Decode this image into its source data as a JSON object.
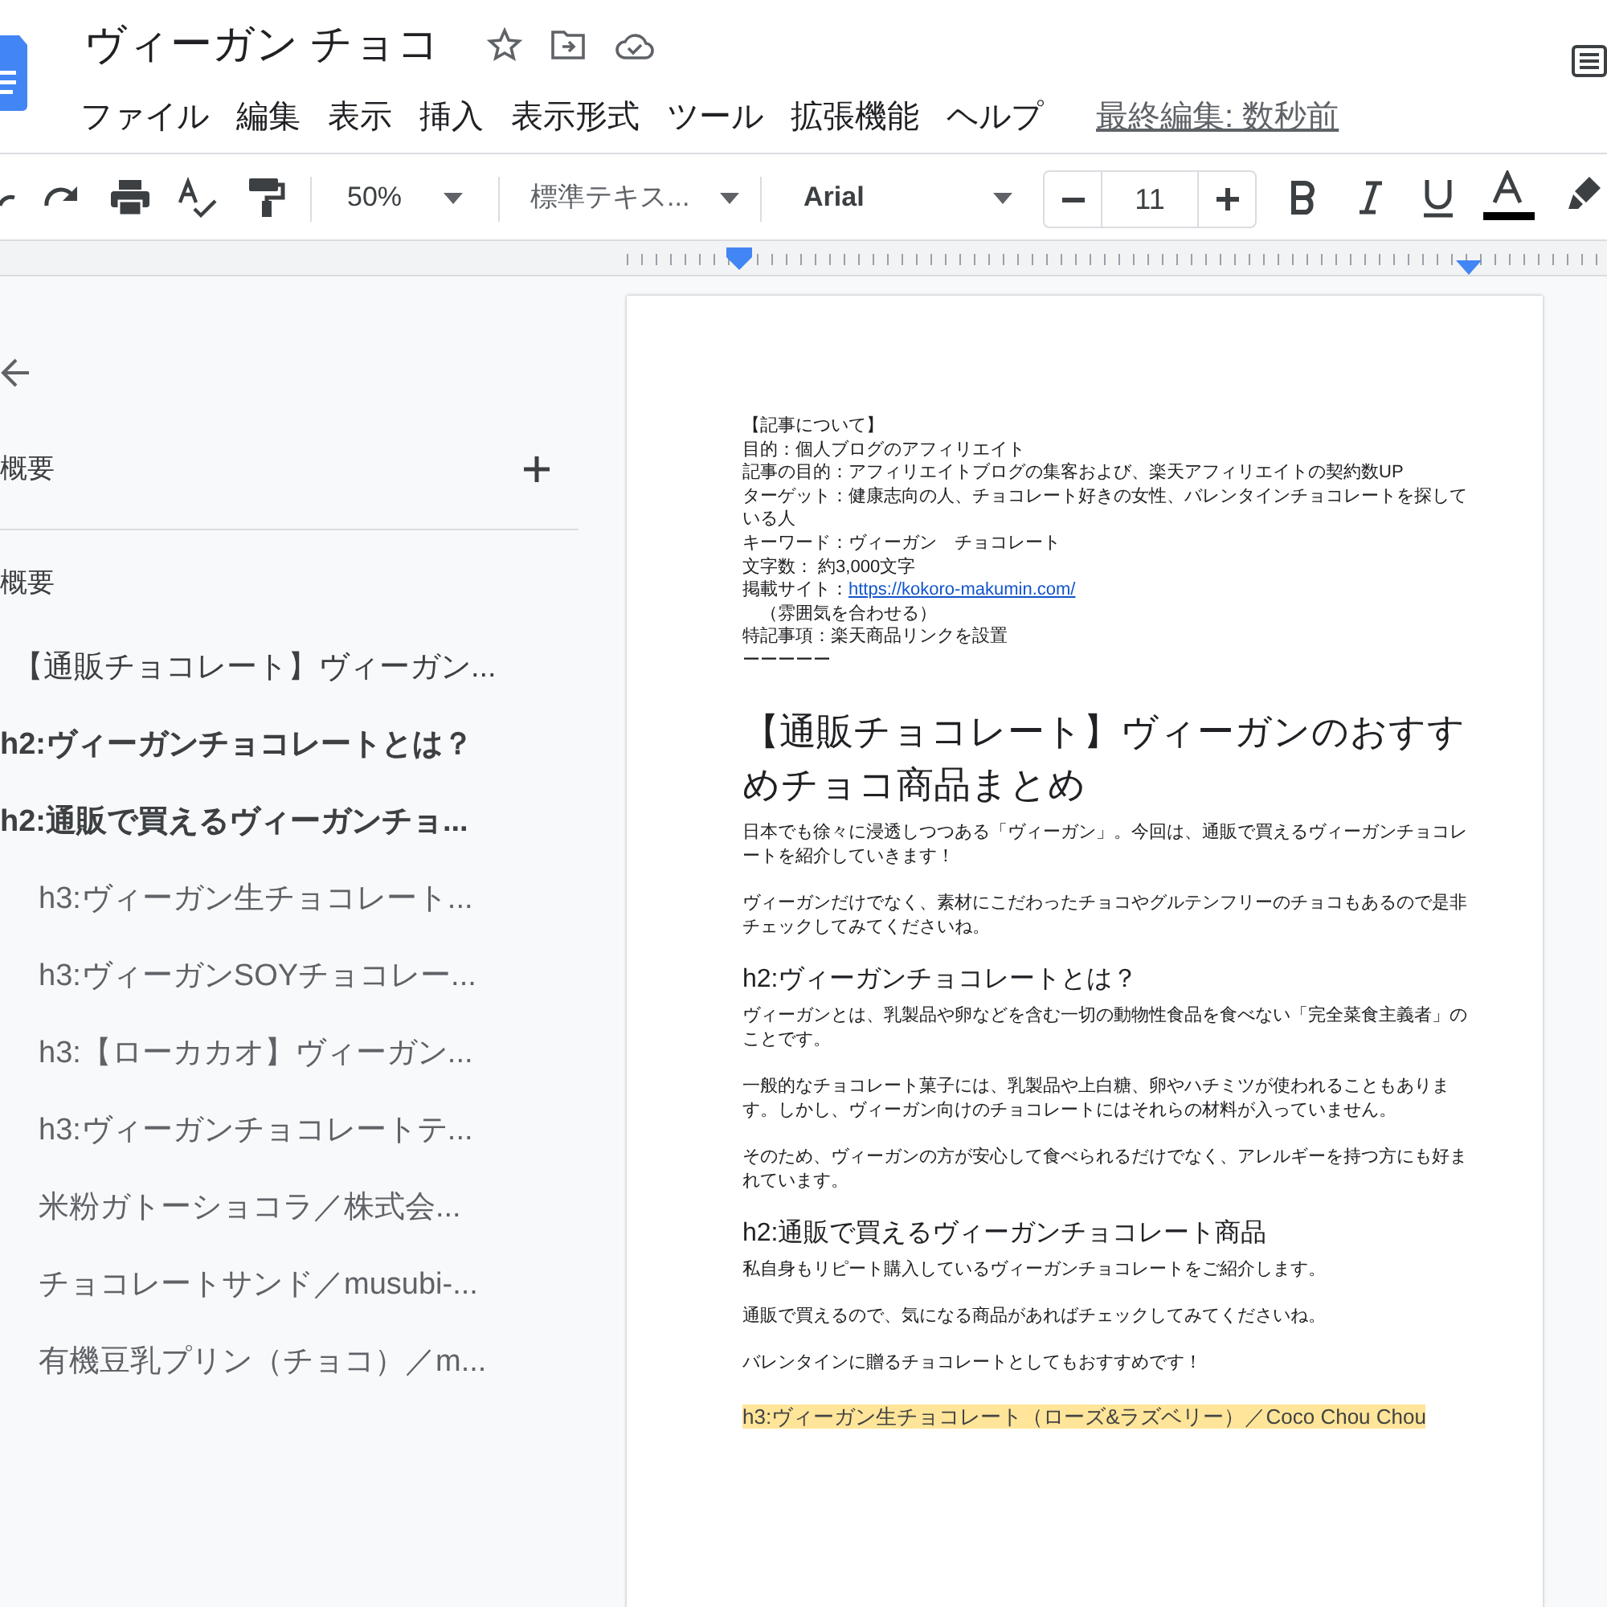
{
  "document": {
    "title": "ヴィーガン チョコ",
    "last_edit": "最終編集: 数秒前"
  },
  "menu": [
    "ファイル",
    "編集",
    "表示",
    "挿入",
    "表示形式",
    "ツール",
    "拡張機能",
    "ヘルプ"
  ],
  "toolbar": {
    "zoom": "50%",
    "style": "標準テキス...",
    "font": "Arial",
    "font_size": "11"
  },
  "outline": {
    "header": "概要",
    "section_label": "概要",
    "items": [
      {
        "kind": "title",
        "text": "【通販チョコレート】ヴィーガン..."
      },
      {
        "kind": "heading",
        "text": "h2:ヴィーガンチョコレートとは？"
      },
      {
        "kind": "heading",
        "text": "h2:通販で買えるヴィーガンチョ...",
        "children": [
          {
            "kind": "sub",
            "text": "h3:ヴィーガン生チョコレート..."
          },
          {
            "kind": "sub",
            "text": "h3:ヴィーガンSOYチョコレー..."
          },
          {
            "kind": "sub",
            "text": "h3:【ローカカオ】ヴィーガン..."
          },
          {
            "kind": "sub",
            "text": "h3:ヴィーガンチョコレートテ..."
          },
          {
            "kind": "sub",
            "text": "米粉ガトーショコラ／株式会..."
          },
          {
            "kind": "sub",
            "text": "チョコレートサンド／musubi-..."
          },
          {
            "kind": "sub",
            "text": "有機豆乳プリン（チョコ）／m..."
          }
        ]
      }
    ]
  },
  "page": [
    {
      "kind": "meta",
      "lines": [
        {
          "text": "【記事について】"
        },
        {
          "text": "目的：個人ブログのアフィリエイト"
        },
        {
          "text": "記事の目的：アフィリエイトブログの集客および、楽天アフィリエイトの契約数UP"
        },
        {
          "text": "ターゲット：健康志向の人、チョコレート好きの女性、バレンタインチョコレートを探している人"
        },
        {
          "text": "キーワード：ヴィーガン　チョコレート"
        },
        {
          "text": "文字数： 約3,000文字"
        },
        {
          "text": "掲載サイト：",
          "link": "https://kokoro-makumin.com/"
        },
        {
          "text": "　（雰囲気を合わせる）"
        },
        {
          "text": "特記事項：楽天商品リンクを設置"
        },
        {
          "text": "ーーーーー"
        }
      ]
    },
    {
      "kind": "title",
      "text": "【通販チョコレート】ヴィーガンのおすすめチョコ商品まとめ"
    },
    {
      "kind": "paragraph",
      "text": "日本でも徐々に浸透しつつある「ヴィーガン」。今回は、通販で買えるヴィーガンチョコレートを紹介していきます！"
    },
    {
      "kind": "paragraph",
      "text": "ヴィーガンだけでなく、素材にこだわったチョコやグルテンフリーのチョコもあるので是非チェックしてみてくださいね。"
    },
    {
      "kind": "h2",
      "text": "h2:ヴィーガンチョコレートとは？"
    },
    {
      "kind": "paragraph",
      "text": "ヴィーガンとは、乳製品や卵などを含む一切の動物性食品を食べない「完全菜食主義者」のことです。"
    },
    {
      "kind": "paragraph",
      "text": "一般的なチョコレート菓子には、乳製品や上白糖、卵やハチミツが使われることもあります。しかし、ヴィーガン向けのチョコレートにはそれらの材料が入っていません。"
    },
    {
      "kind": "paragraph",
      "text": "そのため、ヴィーガンの方が安心して食べられるだけでなく、アレルギーを持つ方にも好まれています。"
    },
    {
      "kind": "h2",
      "text": "h2:通販で買えるヴィーガンチョコレート商品"
    },
    {
      "kind": "paragraph",
      "text": "私自身もリピート購入しているヴィーガンチョコレートをご紹介します。"
    },
    {
      "kind": "paragraph",
      "text": "通販で買えるので、気になる商品があればチェックしてみてくださいね。"
    },
    {
      "kind": "paragraph",
      "text": "バレンタインに贈るチョコレートとしてもおすすめです！"
    },
    {
      "kind": "h3",
      "text": "h3:ヴィーガン生チョコレート（ローズ&ラズベリー）／Coco Chou Chou",
      "highlighted": true
    }
  ]
}
